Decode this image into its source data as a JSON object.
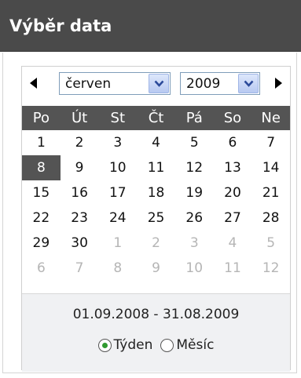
{
  "header": {
    "title": "Výběr data"
  },
  "calendar": {
    "prev_icon": "triangle-left-icon",
    "next_icon": "triangle-right-icon",
    "month_select": {
      "value": "červen",
      "icon": "chevron-down-icon"
    },
    "year_select": {
      "value": "2009",
      "icon": "chevron-down-icon"
    },
    "weekdays": [
      "Po",
      "Út",
      "St",
      "Čt",
      "Pá",
      "So",
      "Ne"
    ],
    "weeks": [
      [
        "1",
        "2",
        "3",
        "4",
        "5",
        "6",
        "7"
      ],
      [
        "8",
        "9",
        "10",
        "11",
        "12",
        "13",
        "14"
      ],
      [
        "15",
        "16",
        "17",
        "18",
        "19",
        "20",
        "21"
      ],
      [
        "22",
        "23",
        "24",
        "25",
        "26",
        "27",
        "28"
      ],
      [
        "29",
        "30",
        "1",
        "2",
        "3",
        "4",
        "5"
      ],
      [
        "6",
        "7",
        "8",
        "9",
        "10",
        "11",
        "12"
      ]
    ],
    "selected_day": "8"
  },
  "footer": {
    "range": "01.09.2008 - 31.08.2009",
    "radio_week": "Týden",
    "radio_month": "Měsíc",
    "selected_mode": "Týden"
  },
  "colors": {
    "header_bg": "#4a4a4a",
    "dow_bg": "#545454",
    "selected_bg": "#545454",
    "radio_dot": "#2f9a2f"
  }
}
